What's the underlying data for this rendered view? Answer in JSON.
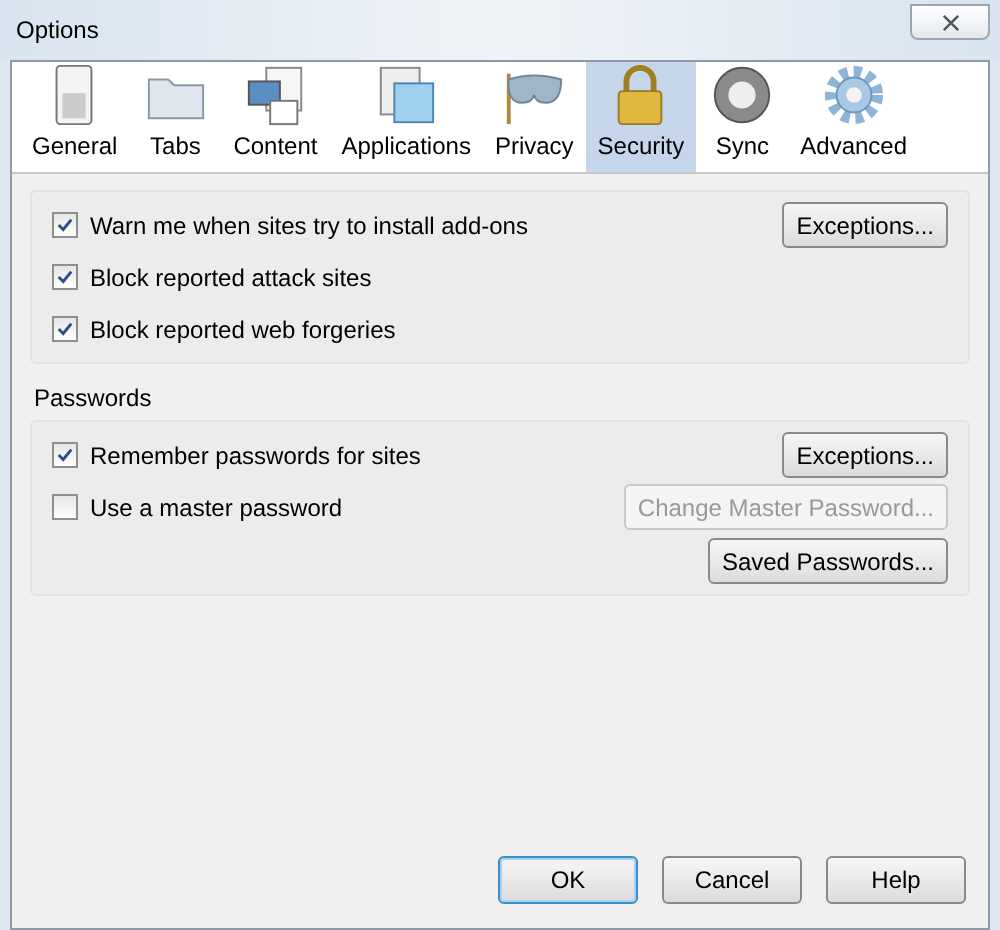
{
  "window": {
    "title": "Options"
  },
  "tabs": [
    {
      "label": "General",
      "selected": false
    },
    {
      "label": "Tabs",
      "selected": false
    },
    {
      "label": "Content",
      "selected": false
    },
    {
      "label": "Applications",
      "selected": false
    },
    {
      "label": "Privacy",
      "selected": false
    },
    {
      "label": "Security",
      "selected": true
    },
    {
      "label": "Sync",
      "selected": false
    },
    {
      "label": "Advanced",
      "selected": false
    }
  ],
  "groups": [
    {
      "rows": [
        {
          "label": "Warn me when sites try to install add-ons",
          "checked": true,
          "buttons": [
            {
              "label": "Exceptions...",
              "disabled": false
            }
          ]
        },
        {
          "label": "Block reported attack sites",
          "checked": true
        },
        {
          "label": "Block reported web forgeries",
          "checked": true
        }
      ]
    },
    {
      "title": "Passwords",
      "rows": [
        {
          "label": "Remember passwords for sites",
          "checked": true,
          "buttons": [
            {
              "label": "Exceptions...",
              "disabled": false
            }
          ]
        },
        {
          "label": "Use a master password",
          "checked": false,
          "buttons": [
            {
              "label": "Change Master Password...",
              "disabled": true
            },
            {
              "label": "Saved Passwords...",
              "disabled": false
            }
          ]
        }
      ]
    }
  ],
  "buttons": [
    {
      "label": "OK",
      "default": true
    },
    {
      "label": "Cancel",
      "default": false
    },
    {
      "label": "Help",
      "default": false
    }
  ]
}
